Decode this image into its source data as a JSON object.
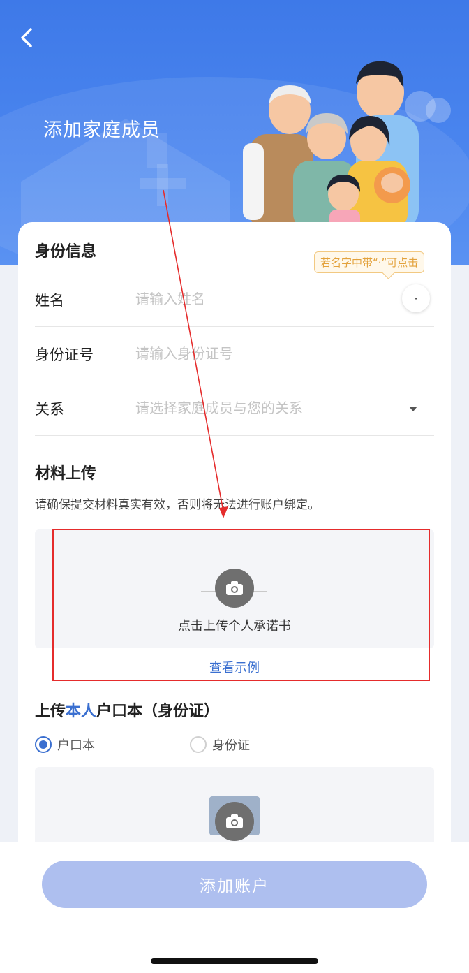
{
  "header": {
    "title": "添加家庭成员"
  },
  "identity": {
    "section_title": "身份信息",
    "tooltip": "若名字中带“·”可点击",
    "dot_button": "·",
    "name": {
      "label": "姓名",
      "placeholder": "请输入姓名",
      "value": ""
    },
    "id_number": {
      "label": "身份证号",
      "placeholder": "请输入身份证号",
      "value": ""
    },
    "relation": {
      "label": "关系",
      "placeholder": "请选择家庭成员与您的关系",
      "value": ""
    }
  },
  "materials": {
    "section_title": "材料上传",
    "hint": "请确保提交材料真实有效，否则将无法进行账户绑定。",
    "upload_label": "点击上传个人承诺书",
    "view_example": "查看示例"
  },
  "household": {
    "title_prefix": "上传",
    "title_highlight": "本人",
    "title_suffix": "户口本（身份证）",
    "options": [
      {
        "label": "户口本",
        "selected": true
      },
      {
        "label": "身份证",
        "selected": false
      }
    ]
  },
  "footer": {
    "add_button": "添加账户"
  },
  "colors": {
    "primary": "#3a6fd0",
    "hero_bg": "#3e79e8",
    "button_disabled": "#aebfef",
    "annotation_red": "#e52c2c",
    "tooltip_text": "#e3a23c"
  }
}
